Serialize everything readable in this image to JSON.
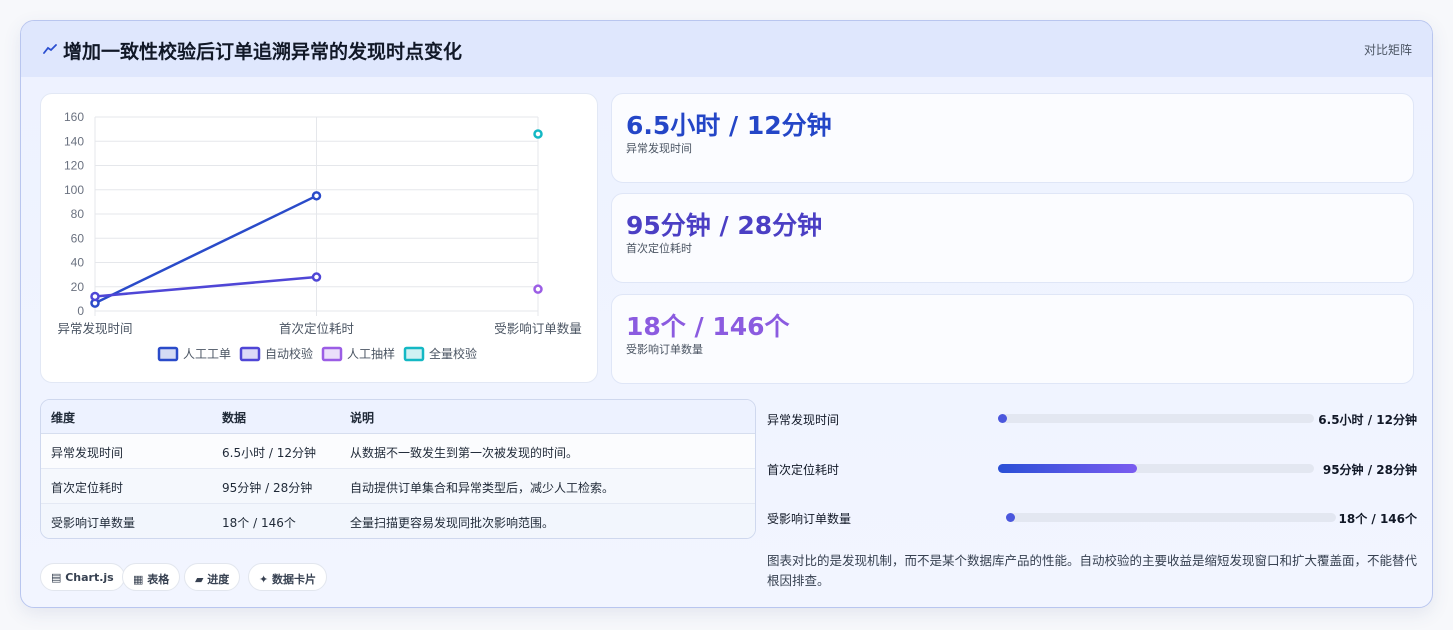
{
  "header": {
    "title": "增加一致性校验后订单追溯异常的发现时点变化",
    "right_label": "对比矩阵",
    "icon": "chart-line-icon"
  },
  "chart_data": {
    "type": "line",
    "categories": [
      "异常发现时间",
      "首次定位耗时",
      "受影响订单数量"
    ],
    "ylim": [
      0,
      160
    ],
    "yticks": [
      "0",
      "20",
      "40",
      "60",
      "80",
      "100",
      "120",
      "140",
      "160"
    ],
    "grid": true,
    "legend_position": "bottom",
    "series": [
      {
        "name": "人工工单",
        "color": "#2a4bc9",
        "values": [
          6.5,
          95,
          null
        ]
      },
      {
        "name": "自动校验",
        "color": "#4f46d6",
        "values": [
          12,
          28,
          null
        ]
      },
      {
        "name": "人工抽样",
        "color": "#9b5de5",
        "values": [
          null,
          null,
          18
        ]
      },
      {
        "name": "全量校验",
        "color": "#14b8c4",
        "values": [
          null,
          null,
          146
        ]
      }
    ]
  },
  "stats": [
    {
      "value": "6.5小时 / 12分钟",
      "label": "异常发现时间",
      "color": "#2446c7"
    },
    {
      "value": "95分钟 / 28分钟",
      "label": "首次定位耗时",
      "color": "#4b3fc4"
    },
    {
      "value": "18个 / 146个",
      "label": "受影响订单数量",
      "color": "#8b5be0"
    }
  ],
  "table": {
    "headers": [
      "维度",
      "数据",
      "说明"
    ],
    "rows": [
      [
        "异常发现时间",
        "6.5小时 / 12分钟",
        "从数据不一致发生到第一次被发现的时间。"
      ],
      [
        "首次定位耗时",
        "95分钟 / 28分钟",
        "自动提供订单集合和异常类型后，减少人工检索。"
      ],
      [
        "受影响订单数量",
        "18个 / 146个",
        "全量扫描更容易发现同批次影响范围。"
      ]
    ]
  },
  "tags": [
    "▤ Chart.js",
    "▦ 表格",
    "▰ 进度",
    "✦ 数据卡片"
  ],
  "progress": [
    {
      "label": "异常发现时间",
      "value": "6.5小时 / 12分钟",
      "fraction": 0.0
    },
    {
      "label": "首次定位耗时",
      "value": "95分钟 / 28分钟",
      "fraction": 0.44
    },
    {
      "label": "受影响订单数量",
      "value": "18个 / 146个",
      "fraction": 0.0
    }
  ],
  "note": "图表对比的是发现机制，而不是某个数据库产品的性能。自动校验的主要收益是缩短发现窗口和扩大覆盖面，不能替代根因排查。"
}
